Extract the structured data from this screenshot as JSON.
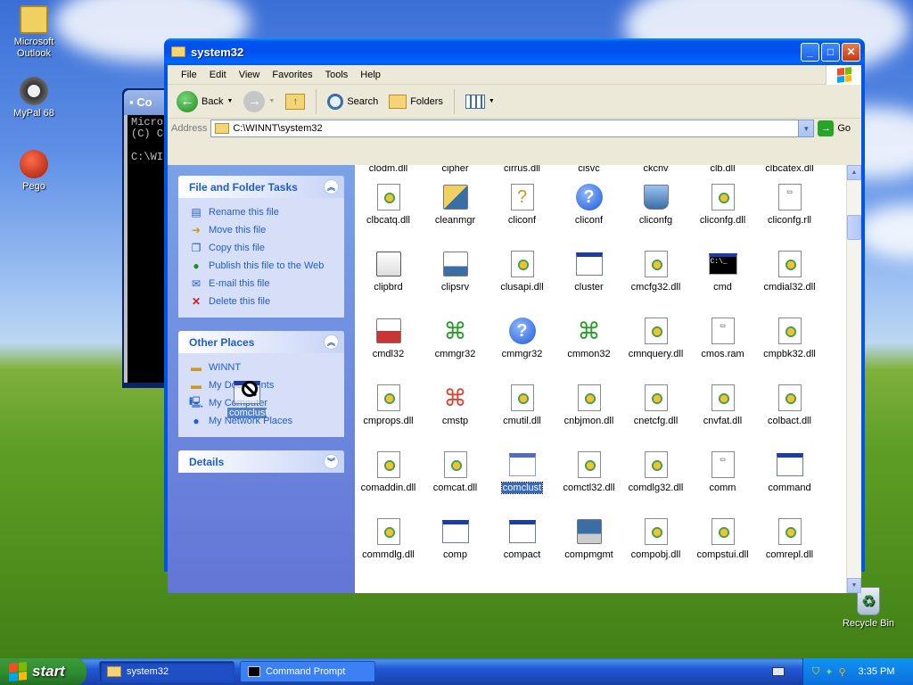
{
  "desktop": {
    "icons": [
      {
        "label": "Microsoft Outlook",
        "icon": "outlook-icon"
      },
      {
        "label": "MyPal 68",
        "icon": "mypal-icon"
      },
      {
        "label": "Pego",
        "icon": "pego-icon"
      },
      {
        "label": "Recycle Bin",
        "icon": "recycle-bin-icon"
      }
    ]
  },
  "cmd_window": {
    "title": "Co",
    "lines": [
      "Micros",
      "(C) Co",
      "",
      "C:\\WII"
    ]
  },
  "explorer": {
    "title": "system32",
    "menu": [
      "File",
      "Edit",
      "View",
      "Favorites",
      "Tools",
      "Help"
    ],
    "toolbar": {
      "back": "Back",
      "search": "Search",
      "folders": "Folders"
    },
    "address": {
      "label": "Address",
      "value": "C:\\WINNT\\system32",
      "go": "Go"
    },
    "tasks_panel": {
      "title": "File and Folder Tasks",
      "items": [
        "Rename this file",
        "Move this file",
        "Copy this file",
        "Publish this file to the Web",
        "E-mail this file",
        "Delete this file"
      ]
    },
    "places_panel": {
      "title": "Other Places",
      "items": [
        "WINNT",
        "My Documents",
        "My Computer",
        "My Network Places"
      ]
    },
    "details_panel": {
      "title": "Details"
    },
    "partial_row": [
      "clodm.dll",
      "cipher",
      "cirrus.dll",
      "cisvc",
      "ckcnv",
      "clb.dll",
      "clbcatex.dll"
    ],
    "files": [
      [
        {
          "n": "clbcatq.dll",
          "t": "dll"
        },
        {
          "n": "cleanmgr",
          "t": "brush"
        },
        {
          "n": "cliconf",
          "t": "yq"
        },
        {
          "n": "cliconf",
          "t": "qm"
        },
        {
          "n": "cliconfg",
          "t": "net"
        },
        {
          "n": "cliconfg.dll",
          "t": "dll"
        },
        {
          "n": "cliconfg.rll",
          "t": "doc"
        }
      ],
      [
        {
          "n": "clipbrd",
          "t": "clip"
        },
        {
          "n": "clipsrv",
          "t": "clipsrv"
        },
        {
          "n": "clusapi.dll",
          "t": "dll"
        },
        {
          "n": "cluster",
          "t": "app"
        },
        {
          "n": "cmcfg32.dll",
          "t": "dll"
        },
        {
          "n": "cmd",
          "t": "cmd"
        },
        {
          "n": "cmdial32.dll",
          "t": "dll"
        }
      ],
      [
        {
          "n": "cmdl32",
          "t": "phone"
        },
        {
          "n": "cmmgr32",
          "t": "cmgr"
        },
        {
          "n": "cmmgr32",
          "t": "qm"
        },
        {
          "n": "cmmon32",
          "t": "cmgr"
        },
        {
          "n": "cmnquery.dll",
          "t": "dll"
        },
        {
          "n": "cmos.ram",
          "t": "doc"
        },
        {
          "n": "cmpbk32.dll",
          "t": "dll"
        }
      ],
      [
        {
          "n": "cmprops.dll",
          "t": "dll"
        },
        {
          "n": "cmstp",
          "t": "cmstp"
        },
        {
          "n": "cmutil.dll",
          "t": "dll"
        },
        {
          "n": "cnbjmon.dll",
          "t": "dll"
        },
        {
          "n": "cnetcfg.dll",
          "t": "dll"
        },
        {
          "n": "cnvfat.dll",
          "t": "dll"
        },
        {
          "n": "colbact.dll",
          "t": "dll"
        }
      ],
      [
        {
          "n": "comaddin.dll",
          "t": "dll"
        },
        {
          "n": "comcat.dll",
          "t": "dll"
        },
        {
          "n": "comclust",
          "t": "app",
          "sel": true
        },
        {
          "n": "comctl32.dll",
          "t": "dll"
        },
        {
          "n": "comdlg32.dll",
          "t": "dll"
        },
        {
          "n": "comm",
          "t": "doc"
        },
        {
          "n": "command",
          "t": "app"
        }
      ],
      [
        {
          "n": "commdlg.dll",
          "t": "dll"
        },
        {
          "n": "comp",
          "t": "app"
        },
        {
          "n": "compact",
          "t": "app"
        },
        {
          "n": "compmgmt",
          "t": "pc"
        },
        {
          "n": "compobj.dll",
          "t": "dll"
        },
        {
          "n": "compstui.dll",
          "t": "dll"
        },
        {
          "n": "comrepl.dll",
          "t": "dll"
        }
      ]
    ],
    "drag_label": "comclust"
  },
  "taskbar": {
    "start": "start",
    "buttons": [
      {
        "label": "system32",
        "icon": "folder-icon"
      },
      {
        "label": "Command Prompt",
        "icon": "cmd-icon"
      }
    ],
    "clock": "3:35 PM"
  }
}
